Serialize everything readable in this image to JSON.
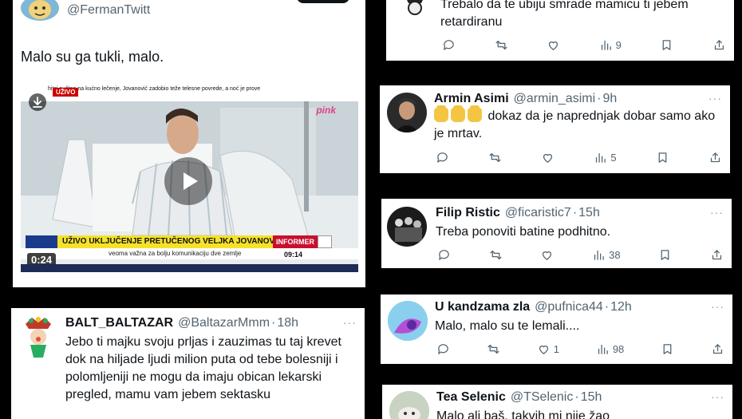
{
  "tweets": {
    "main": {
      "handle": "@FermanTwitt",
      "text": "Malo su ga tukli, malo.",
      "video": {
        "live_badge": "UŽIVO",
        "ticker": "hitci pušten na kućno lečenje, Jovanović zadobio teže telesne povrede, a noć je prove",
        "headline": "UŽIVO UKLJUČENJE PRETUČENOG VELJKA JOVANOVIĆA",
        "subline": "veoma važna za bolju komunikaciju dve zemlje",
        "channel_tag": "pink",
        "clock": "09:14",
        "informer": "INFORMER",
        "duration": "0:24"
      }
    },
    "t1": {
      "text": "Trebalo da te ubiju smrade mamicu ti jebem retardiranu",
      "views": "9"
    },
    "t2": {
      "name": "Armin Asimi",
      "handle": "@armin_asimi",
      "time": "9h",
      "text": "dokaz da je naprednjak dobar samo ako je mrtav.",
      "views": "5"
    },
    "t3": {
      "name": "Filip Ristic",
      "handle": "@ficaristic7",
      "time": "15h",
      "text": "Treba ponoviti batine podhitno.",
      "views": "38"
    },
    "t4": {
      "name": "BALT_BALTAZAR",
      "handle": "@BaltazarMmm",
      "time": "18h",
      "text": "Jebo ti majku svoju prljas i zauzimas tu taj krevet dok na hiljade ljudi  milion puta od tebe bolesniji i polomljeniji ne mogu da imaju obican lekarski pregled, mamu vam jebem sektasku"
    },
    "t5": {
      "name": "U kandzama zla",
      "handle": "@pufnica44",
      "time": "12h",
      "text": "Malo, malo su te lemali....",
      "likes": "1",
      "views": "98"
    },
    "t6": {
      "name": "Tea Selenic",
      "handle": "@TSelenic",
      "time": "15h",
      "text": "Malo ali baš, takvih mi nije žao"
    },
    "dots": "···",
    "sep": "·"
  },
  "icons": [
    "reply-icon",
    "retweet-icon",
    "like-icon",
    "views-icon",
    "bookmark-icon",
    "share-icon",
    "more-icon",
    "play-icon",
    "download-icon"
  ]
}
